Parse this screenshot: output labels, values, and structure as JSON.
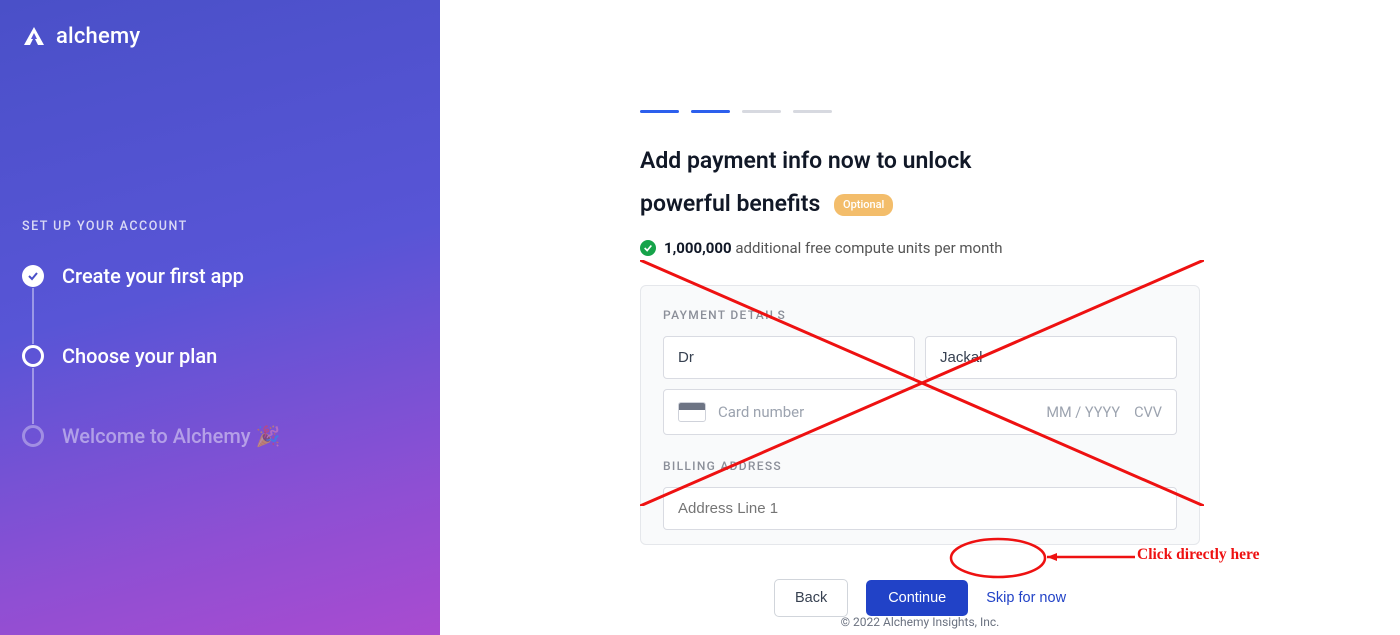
{
  "brand": "alchemy",
  "sidebar": {
    "section_title": "SET UP YOUR ACCOUNT",
    "steps": [
      "Create your first app",
      "Choose your plan",
      "Welcome to Alchemy 🎉"
    ]
  },
  "main": {
    "title_line1": "Add payment info now to unlock",
    "title_line2": "powerful benefits",
    "badge": "Optional",
    "benefit_amount": "1,000,000",
    "benefit_text": "additional free compute units per month",
    "payment_details_label": "PAYMENT DETAILS",
    "first_name": "Dr",
    "last_name": "Jackal",
    "card_placeholder": "Card number",
    "expiry_placeholder": "MM / YYYY",
    "cvv_placeholder": "CVV",
    "billing_address_label": "BILLING ADDRESS",
    "address_placeholder": "Address Line 1",
    "buttons": {
      "back": "Back",
      "continue": "Continue",
      "skip": "Skip for now"
    },
    "footer": "© 2022 Alchemy Insights, Inc."
  },
  "annotation": {
    "text": "Click directly here"
  }
}
